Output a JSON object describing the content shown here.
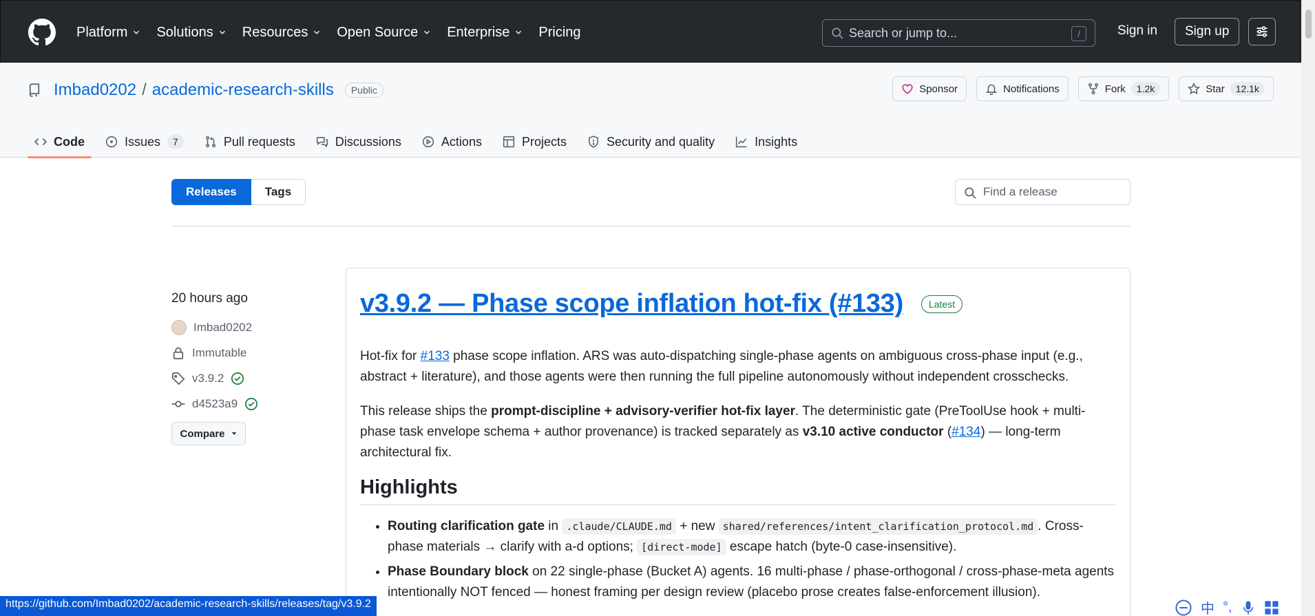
{
  "header": {
    "nav": [
      "Platform",
      "Solutions",
      "Resources",
      "Open Source",
      "Enterprise",
      "Pricing"
    ],
    "search_placeholder": "Search or jump to...",
    "search_shortcut": "/",
    "sign_in": "Sign in",
    "sign_up": "Sign up"
  },
  "repo": {
    "owner": "Imbad0202",
    "separator": "/",
    "name": "academic-research-skills",
    "visibility": "Public",
    "sponsor": "Sponsor",
    "notifications": "Notifications",
    "fork_label": "Fork",
    "fork_count": "1.2k",
    "star_label": "Star",
    "star_count": "12.1k"
  },
  "tabs": [
    {
      "label": "Code"
    },
    {
      "label": "Issues",
      "count": "7"
    },
    {
      "label": "Pull requests"
    },
    {
      "label": "Discussions"
    },
    {
      "label": "Actions"
    },
    {
      "label": "Projects"
    },
    {
      "label": "Security and quality"
    },
    {
      "label": "Insights"
    }
  ],
  "subnav": {
    "releases": "Releases",
    "tags": "Tags",
    "find_placeholder": "Find a release"
  },
  "release": {
    "time": "20 hours ago",
    "author": "Imbad0202",
    "immutable": "Immutable",
    "tag": "v3.9.2",
    "commit": "d4523a9",
    "compare": "Compare",
    "title": "v3.9.2 — Phase scope inflation hot-fix (#133)",
    "latest": "Latest",
    "p1_a": "Hot-fix for ",
    "p1_link": "#133",
    "p1_b": " phase scope inflation. ARS was auto-dispatching single-phase agents on ambiguous cross-phase input (e.g., abstract + literature), and those agents were then running the full pipeline autonomously without independent crosschecks.",
    "p2_a": "This release ships the ",
    "p2_bold": "prompt-discipline + advisory-verifier hot-fix layer",
    "p2_b": ". The deterministic gate (PreToolUse hook + multi-phase task envelope schema + author provenance) is tracked separately as ",
    "p2_bold2": "v3.10 active conductor",
    "p2_c": " (",
    "p2_link": "#134",
    "p2_d": ") — long-term architectural fix.",
    "highlights": "Highlights",
    "li1_bold": "Routing clarification gate",
    "li1_a": " in ",
    "li1_code1": ".claude/CLAUDE.md",
    "li1_b": " + new ",
    "li1_code2": "shared/references/intent_clarification_protocol.md",
    "li1_c": ". Cross-phase materials → clarify with a-d options; ",
    "li1_code3": "[direct-mode]",
    "li1_d": " escape hatch (byte-0 case-insensitive).",
    "li2_bold": "Phase Boundary block",
    "li2_a": " on 22 single-phase (Bucket A) agents. 16 multi-phase / phase-orthogonal / cross-phase-meta agents intentionally NOT fenced — honest framing per design review (placebo prose creates false-enforcement illusion)."
  },
  "status_url": "https://github.com/Imbad0202/academic-research-skills/releases/tag/v3.9.2",
  "ime": {
    "lang": "中",
    "punct": "°,"
  }
}
